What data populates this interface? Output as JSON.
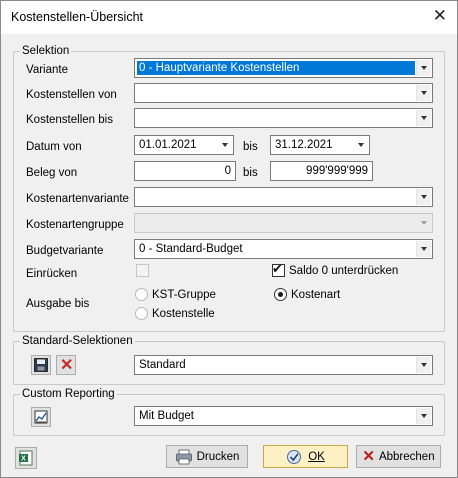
{
  "window": {
    "title": "Kostenstellen-Übersicht"
  },
  "selektion": {
    "legend": "Selektion",
    "variante": {
      "label": "Variante",
      "value": "0 - Hauptvariante Kostenstellen"
    },
    "kst_von": {
      "label": "Kostenstellen von",
      "value": ""
    },
    "kst_bis": {
      "label": "Kostenstellen bis",
      "value": ""
    },
    "datum": {
      "label": "Datum von",
      "from": "01.01.2021",
      "bis_label": "bis",
      "to": "31.12.2021"
    },
    "beleg": {
      "label": "Beleg von",
      "from": "0",
      "bis_label": "bis",
      "to": "999'999'999"
    },
    "kostenartenvariante": {
      "label": "Kostenartenvariante",
      "value": ""
    },
    "kostenartengruppe": {
      "label": "Kostenartengruppe",
      "value": ""
    },
    "budgetvariante": {
      "label": "Budgetvariante",
      "value": "0 - Standard-Budget"
    },
    "einruecken": {
      "label": "Einrücken",
      "checked": false
    },
    "saldo": {
      "label": "Saldo 0 unterdrücken",
      "checked": true
    },
    "ausgabe": {
      "label": "Ausgabe bis",
      "options": [
        "KST-Gruppe",
        "Kostenart",
        "Kostenstelle"
      ],
      "selected": "Kostenart"
    }
  },
  "standard_selektionen": {
    "legend": "Standard-Selektionen",
    "value": "Standard"
  },
  "custom_reporting": {
    "legend": "Custom Reporting",
    "value": "Mit Budget"
  },
  "buttons": {
    "print": "Drucken",
    "ok": "OK",
    "cancel": "Abbrechen"
  },
  "colors": {
    "selection": "#0078d7",
    "default_button": "#fdf0c4",
    "delete_x": "#c62828"
  }
}
